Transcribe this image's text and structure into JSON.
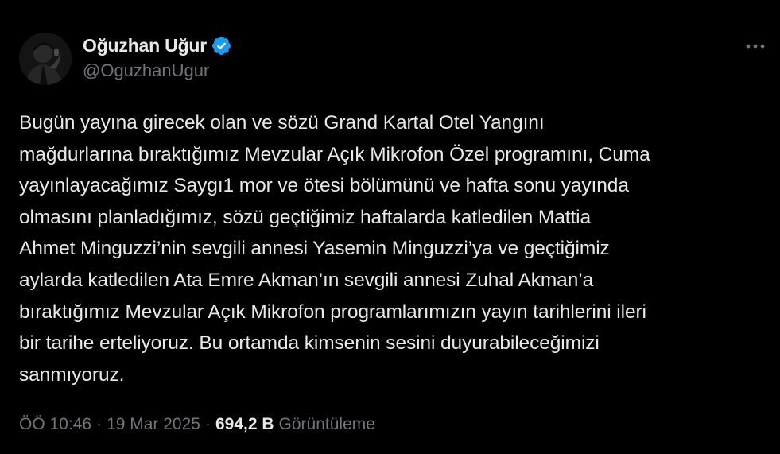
{
  "author": {
    "display_name": "Oğuzhan Uğur",
    "handle": "@OguzhanUgur",
    "verified": true
  },
  "tweet": {
    "text": "Bugün yayına girecek olan ve sözü Grand Kartal Otel Yangını\nmağdurlarına bıraktığımız Mevzular Açık Mikrofon Özel programını, Cuma\nyayınlayacağımız Saygı1 mor ve ötesi bölümünü ve hafta sonu yayında\nolmasını planladığımız, sözü geçtiğimiz haftalarda katledilen Mattia\nAhmet Minguzzi’nin sevgili annesi Yasemin Minguzzi’ya ve geçtiğimiz\naylarda katledilen Ata Emre Akman’ın sevgili annesi Zuhal Akman’a\nbıraktığımız Mevzular Açık Mikrofon programlarımızın yayın tarihlerini ileri\nbir tarihe erteliyoruz. Bu ortamda kimsenin sesini duyurabileceğimizi\nsanmıyoruz."
  },
  "meta": {
    "time": "ÖÖ 10:46",
    "separator": "·",
    "date": "19 Mar 2025",
    "views_count": "694,2 B",
    "views_label": "Görüntüleme"
  },
  "icons": {
    "verified": "verified-badge-icon",
    "more": "more-options-icon"
  },
  "colors": {
    "background": "#000000",
    "primary_text": "#e7e9ea",
    "secondary_text": "#71767b",
    "verified_blue": "#1d9bf0"
  }
}
